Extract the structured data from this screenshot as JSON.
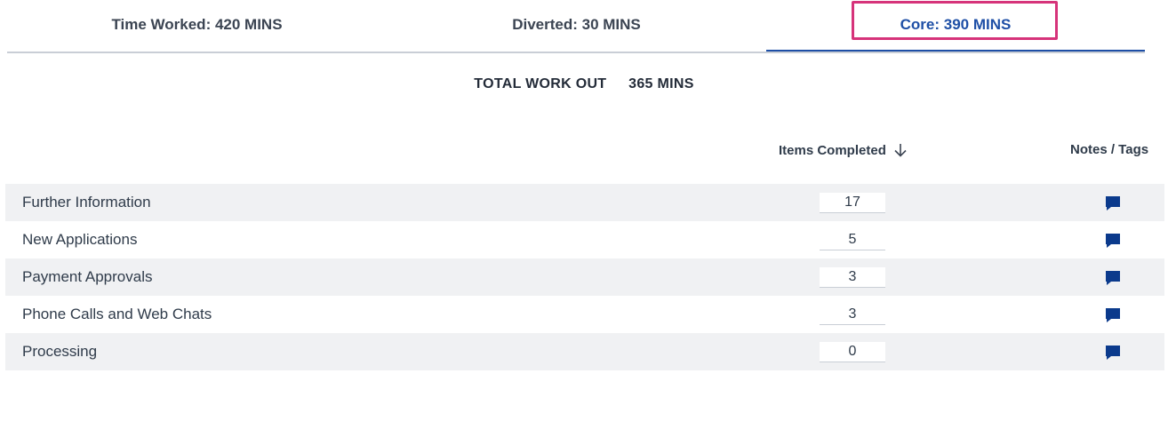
{
  "tabs": [
    {
      "label": "Time Worked: 420 MINS"
    },
    {
      "label": "Diverted: 30 MINS"
    },
    {
      "label": "Core: 390 MINS"
    }
  ],
  "summary": {
    "label": "TOTAL WORK OUT",
    "value": "365",
    "unit": "MINS"
  },
  "columns": {
    "items": "Items Completed",
    "notes": "Notes / Tags"
  },
  "rows": [
    {
      "label": "Further Information",
      "count": "17"
    },
    {
      "label": "New Applications",
      "count": "5"
    },
    {
      "label": "Payment Approvals",
      "count": "3"
    },
    {
      "label": "Phone Calls and Web Chats",
      "count": "3"
    },
    {
      "label": "Processing",
      "count": "0"
    }
  ],
  "icons": {
    "sort": "arrow-down-icon",
    "notes": "comment-icon"
  },
  "colors": {
    "accent": "#1e4fa6",
    "highlight": "#d6337a",
    "row_alt": "#f0f1f3",
    "note_icon": "#0b3a8c"
  },
  "active_tab": 2
}
